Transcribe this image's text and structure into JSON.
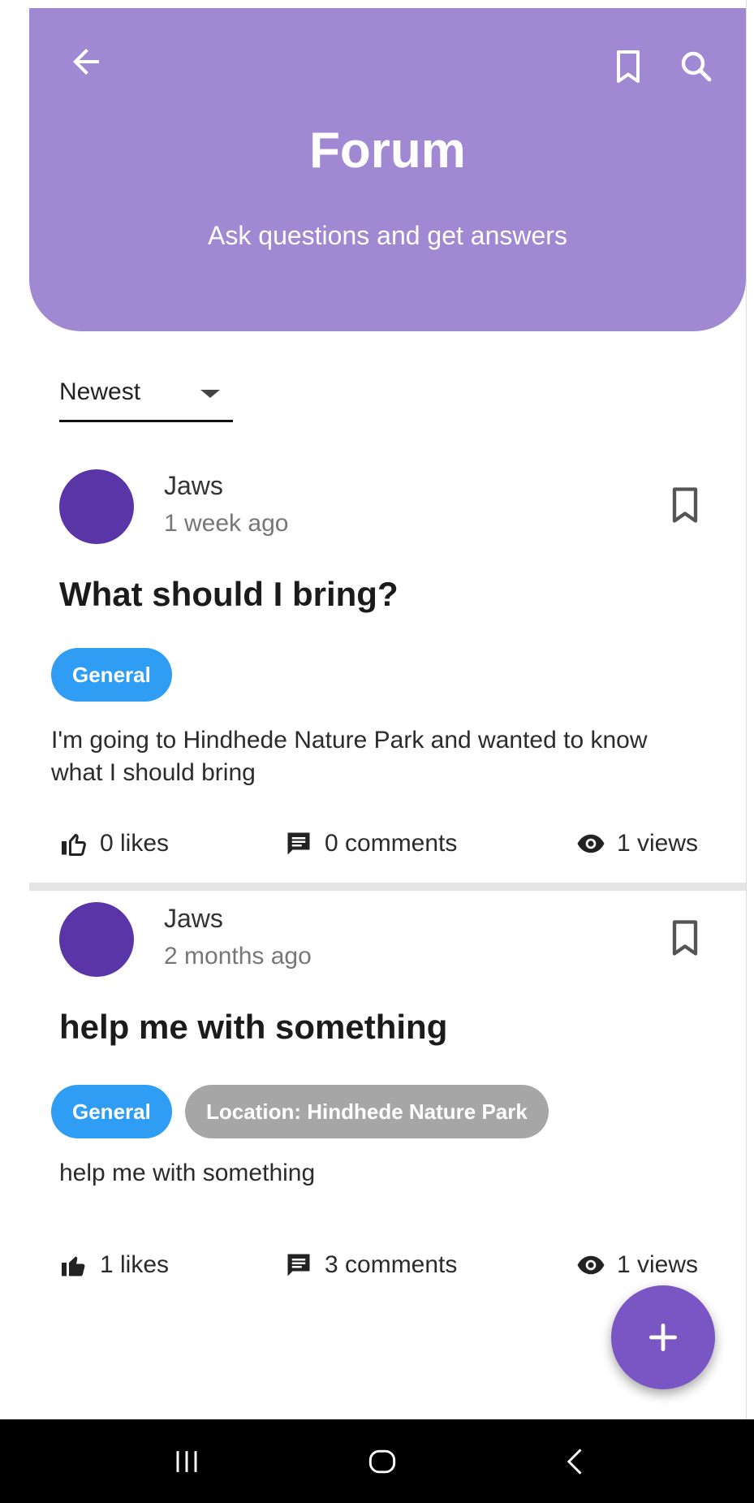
{
  "header": {
    "title": "Forum",
    "subtitle": "Ask questions and get answers",
    "bg_color": "#a088d2",
    "icons": [
      "back-arrow-icon",
      "bookmark-icon",
      "search-icon"
    ]
  },
  "sort": {
    "selected": "Newest"
  },
  "posts": [
    {
      "author": "Jaws",
      "time": "1 week ago",
      "title": "What should I bring?",
      "tags": [
        "General"
      ],
      "body": "I'm going to Hindhede Nature Park and wanted to know what I should bring",
      "likes": "0 likes",
      "comments": "0 comments",
      "views": "1 views",
      "liked": false
    },
    {
      "author": "Jaws",
      "time": "2 months ago",
      "title": "help me with something",
      "tags": [
        "General",
        "Location: Hindhede Nature Park"
      ],
      "body": "help me with something",
      "likes": "1 likes",
      "comments": "3 comments",
      "views": "1 views",
      "liked": true
    }
  ],
  "fab": {
    "icon": "plus-icon",
    "color": "#7a55c4"
  },
  "system_nav": {
    "icons": [
      "recents-icon",
      "home-icon",
      "back-icon"
    ]
  }
}
